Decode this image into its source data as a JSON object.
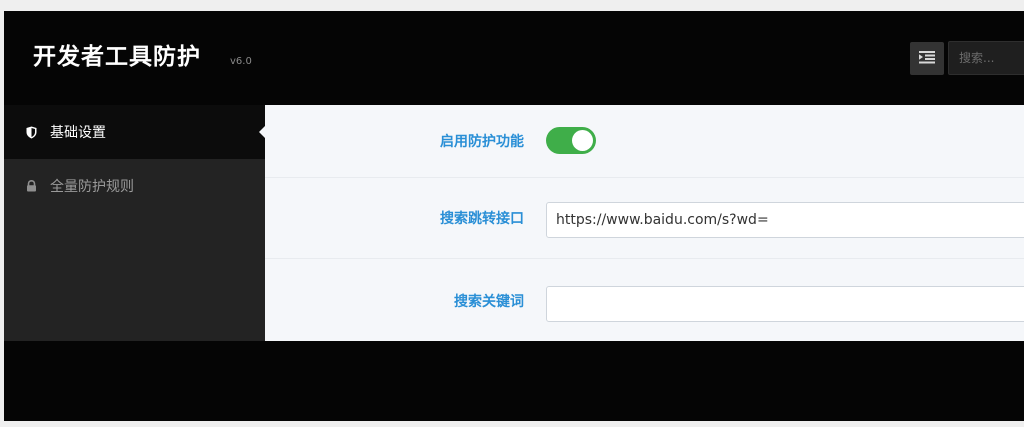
{
  "header": {
    "title": "开发者工具防护",
    "version": "v6.0",
    "search_placeholder": "搜索..."
  },
  "sidebar": {
    "items": [
      {
        "label": "基础设置",
        "icon": "shield-icon",
        "active": true
      },
      {
        "label": "全量防护规则",
        "icon": "lock-icon",
        "active": false
      }
    ]
  },
  "form": {
    "enable": {
      "label": "启用防护功能",
      "checked": true
    },
    "api": {
      "label": "搜索跳转接口",
      "value": "https://www.baidu.com/s?wd="
    },
    "keyword": {
      "label": "搜索关键词",
      "value": ""
    }
  },
  "colors": {
    "accent": "#2a8fd6",
    "toggle_on": "#3fae49",
    "sidebar_bg": "#232323",
    "header_bg": "#050505"
  }
}
